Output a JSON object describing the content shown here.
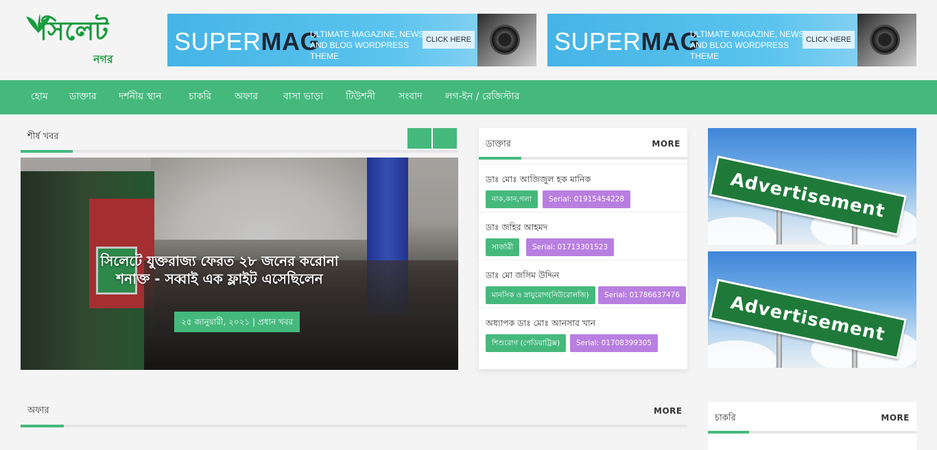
{
  "logo": {
    "main": "সিলেট",
    "sub": "নগর"
  },
  "banners": [
    {
      "brand_light": "SUPER",
      "brand_bold": "MAG",
      "sub": "Ultimate Magazine, News and Blog WordPress Theme",
      "cta": "CLICK HERE"
    },
    {
      "brand_light": "SUPER",
      "brand_bold": "MAG",
      "sub": "Ultimate Magazine, News and Blog WordPress Theme",
      "cta": "CLICK HERE"
    }
  ],
  "nav": [
    "হোম",
    "ডাক্তার",
    "দর্শনীয় স্থান",
    "চাকরি",
    "অফার",
    "বাসা ভাড়া",
    "টিউশনী",
    "সংবাদ",
    "লগ-ইন / রেজিস্টার"
  ],
  "top_news": {
    "heading": "শীর্ষ খবর",
    "prev_icon": "",
    "next_icon": "",
    "title": "সিলেটে যুক্তরাজ্য ফেরত ২৮ জনের করোনা শনাক্ত - সব্বাই এক ফ্লাইট এসেছিলেন",
    "meta": "২৫ জানুয়ারী, ২০২১ | প্রধান খবর"
  },
  "doctors": {
    "title": "ডাক্তার",
    "more": "MORE",
    "items": [
      {
        "name": "ডাঃ মোঃ আজিজুল হক মানিক",
        "specialty": "নাক,কান,গলা",
        "serial": "Serial: 01915454228"
      },
      {
        "name": "ডাঃ জহির আহমদ",
        "specialty": "সার্জারী",
        "serial": "Serial: 01713301523"
      },
      {
        "name": "ডাঃ মো জসিম উদ্দিন",
        "specialty": "মানসিক ও স্নায়ুরোগ(নিউরোলজি)",
        "serial": "Serial: 01786637476"
      },
      {
        "name": "অধ্যাপক ডাঃ মোঃ আনসার খান",
        "specialty": "শিশুরোগ (পেডিয়াট্রিক্স)",
        "serial": "Serial: 01708399305"
      }
    ]
  },
  "ads": [
    {
      "text": "Advertisement"
    },
    {
      "text": "Advertisement"
    }
  ],
  "offers": {
    "title": "অফার",
    "more": "MORE"
  },
  "jobs": {
    "title": "চাকরি",
    "more": "MORE"
  },
  "colors": {
    "accent": "#45b97c",
    "purple": "#b87fe0",
    "logo": "#1a9c3e"
  }
}
